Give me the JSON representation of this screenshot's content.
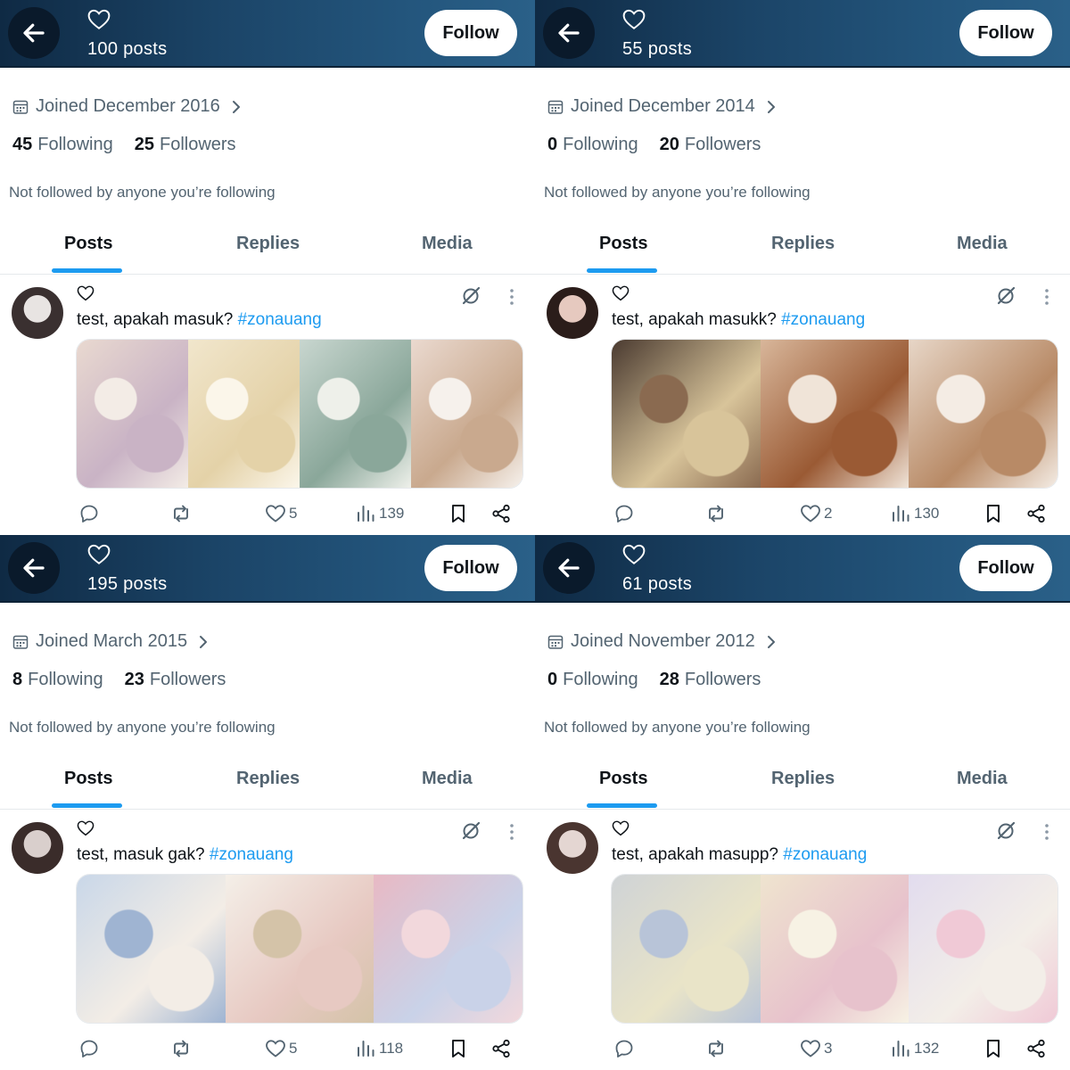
{
  "panels": [
    {
      "posts_count": "100 posts",
      "follow_label": "Follow",
      "joined": "Joined December 2016",
      "following_count": "45",
      "following_label": "Following",
      "followers_count": "25",
      "followers_label": "Followers",
      "not_followed": "Not followed by anyone you’re following",
      "tabs": [
        "Posts",
        "Replies",
        "Media"
      ],
      "post": {
        "text": "test, apakah masuk? ",
        "hashtag": "#zonauang",
        "likes": "5",
        "views": "139"
      },
      "colors": {
        "avatar": [
          "#e8e4e2",
          "#3a3030"
        ],
        "tiles": [
          [
            "#e9d9d0",
            "#c9b3c5",
            "#f3ece6"
          ],
          [
            "#f1e6cc",
            "#e4d2a8",
            "#fbf6ea"
          ],
          [
            "#c8d6cf",
            "#8aa79a",
            "#eef0ea"
          ],
          [
            "#ead9cf",
            "#c9a98e",
            "#f6f1ec"
          ]
        ]
      }
    },
    {
      "posts_count": "55 posts",
      "follow_label": "Follow",
      "joined": "Joined December 2014",
      "following_count": "0",
      "following_label": "Following",
      "followers_count": "20",
      "followers_label": "Followers",
      "not_followed": "Not followed by anyone you’re following",
      "tabs": [
        "Posts",
        "Replies",
        "Media"
      ],
      "post": {
        "text": "test, apakah masukk? ",
        "hashtag": "#zonauang",
        "likes": "2",
        "views": "130"
      },
      "colors": {
        "avatar": [
          "#e6c9bf",
          "#2b1d1a"
        ],
        "tiles": [
          [
            "#4a3a30",
            "#d8c49a",
            "#8a6a50"
          ],
          [
            "#d8b69a",
            "#9a5a34",
            "#f0e4d8"
          ],
          [
            "#e7d6c7",
            "#b88a66",
            "#f4ece4"
          ]
        ]
      }
    },
    {
      "posts_count": "195 posts",
      "follow_label": "Follow",
      "joined": "Joined March 2015",
      "following_count": "8",
      "following_label": "Following",
      "followers_count": "23",
      "followers_label": "Followers",
      "not_followed": "Not followed by anyone you’re following",
      "tabs": [
        "Posts",
        "Replies",
        "Media"
      ],
      "post": {
        "text": "test, masuk gak? ",
        "hashtag": "#zonauang",
        "likes": "5",
        "views": "118"
      },
      "colors": {
        "avatar": [
          "#d9cfcc",
          "#3a2c2a"
        ],
        "tiles": [
          [
            "#c9d7e8",
            "#f3ede6",
            "#9fb4d2"
          ],
          [
            "#f4efe8",
            "#e7c9c2",
            "#d4c3a8"
          ],
          [
            "#e8b9c4",
            "#c9d2e8",
            "#f2d8dc"
          ]
        ]
      }
    },
    {
      "posts_count": "61 posts",
      "follow_label": "Follow",
      "joined": "Joined November 2012",
      "following_count": "0",
      "following_label": "Following",
      "followers_count": "28",
      "followers_label": "Followers",
      "not_followed": "Not followed by anyone you’re following",
      "tabs": [
        "Posts",
        "Replies",
        "Media"
      ],
      "post": {
        "text": "test, apakah masupp? ",
        "hashtag": "#zonauang",
        "likes": "3",
        "views": "132"
      },
      "colors": {
        "avatar": [
          "#e4d6d2",
          "#4a3530"
        ],
        "tiles": [
          [
            "#cfd3d6",
            "#e9e4c8",
            "#b8c4d8"
          ],
          [
            "#efe4cf",
            "#e7c2cc",
            "#f7f2e4"
          ],
          [
            "#e2dcee",
            "#f3eee8",
            "#f0c9d6"
          ]
        ]
      }
    }
  ]
}
